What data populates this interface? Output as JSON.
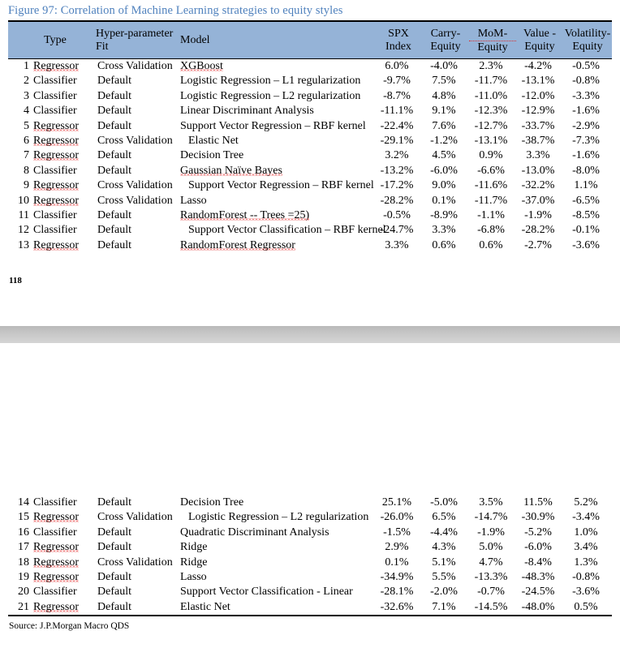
{
  "figure": {
    "caption": "Figure 97: Correlation of Machine Learning strategies to equity styles",
    "caption_color": "#4f81bd"
  },
  "page_number": "118",
  "source": "Source: J.P.Morgan Macro QDS",
  "table": {
    "header_bg": "#95b3d7",
    "columns": [
      {
        "key": "index",
        "label": ""
      },
      {
        "key": "type",
        "label": "Type"
      },
      {
        "key": "hyper_line1",
        "label": "Hyper-parameter"
      },
      {
        "key": "hyper_line2",
        "label": "Fit"
      },
      {
        "key": "model",
        "label": "Model"
      },
      {
        "key": "spx_line1",
        "label": "SPX"
      },
      {
        "key": "spx_line2",
        "label": "Index"
      },
      {
        "key": "carry_line1",
        "label": "Carry-"
      },
      {
        "key": "carry_line2",
        "label": "Equity"
      },
      {
        "key": "mom_line1",
        "label": "MoM-"
      },
      {
        "key": "mom_line2",
        "label": "Equity"
      },
      {
        "key": "value_line1",
        "label": "Value -"
      },
      {
        "key": "value_line2",
        "label": "Equity"
      },
      {
        "key": "vol_line1",
        "label": "Volatility-"
      },
      {
        "key": "vol_line2",
        "label": "Equity"
      }
    ],
    "rows_top": [
      {
        "index": "1",
        "type": "Regressor",
        "hyper": "Cross Validation",
        "model": "XGBoost",
        "indent": false,
        "spx": "6.0%",
        "carry": "-4.0%",
        "mom": "2.3%",
        "value": "-4.2%",
        "vol": "-0.5%"
      },
      {
        "index": "2",
        "type": "Classifier",
        "hyper": "Default",
        "model": "Logistic Regression – L1 regularization",
        "indent": false,
        "spx": "-9.7%",
        "carry": "7.5%",
        "mom": "-11.7%",
        "value": "-13.1%",
        "vol": "-0.8%"
      },
      {
        "index": "3",
        "type": "Classifier",
        "hyper": "Default",
        "model": "Logistic Regression – L2 regularization",
        "indent": false,
        "spx": "-8.7%",
        "carry": "4.8%",
        "mom": "-11.0%",
        "value": "-12.0%",
        "vol": "-3.3%"
      },
      {
        "index": "4",
        "type": "Classifier",
        "hyper": "Default",
        "model": "Linear Discriminant Analysis",
        "indent": false,
        "spx": "-11.1%",
        "carry": "9.1%",
        "mom": "-12.3%",
        "value": "-12.9%",
        "vol": "-1.6%"
      },
      {
        "index": "5",
        "type": "Regressor",
        "hyper": "Default",
        "model": "Support Vector Regression – RBF kernel",
        "indent": false,
        "spx": "-22.4%",
        "carry": "7.6%",
        "mom": "-12.7%",
        "value": "-33.7%",
        "vol": "-2.9%"
      },
      {
        "index": "6",
        "type": "Regressor",
        "hyper": "Cross Validation",
        "model": "Elastic Net",
        "indent": true,
        "spx": "-29.1%",
        "carry": "-1.2%",
        "mom": "-13.1%",
        "value": "-38.7%",
        "vol": "-7.3%"
      },
      {
        "index": "7",
        "type": "Regressor",
        "hyper": "Default",
        "model": "Decision Tree",
        "indent": false,
        "spx": "3.2%",
        "carry": "4.5%",
        "mom": "0.9%",
        "value": "3.3%",
        "vol": "-1.6%"
      },
      {
        "index": "8",
        "type": "Classifier",
        "hyper": "Default",
        "model": "Gaussian Naïve Bayes",
        "indent": false,
        "spx": "-13.2%",
        "carry": "-6.0%",
        "mom": "-6.6%",
        "value": "-13.0%",
        "vol": "-8.0%"
      },
      {
        "index": "9",
        "type": "Regressor",
        "hyper": "Cross Validation",
        "model": "Support Vector Regression – RBF kernel",
        "indent": true,
        "spx": "-17.2%",
        "carry": "9.0%",
        "mom": "-11.6%",
        "value": "-32.2%",
        "vol": "1.1%"
      },
      {
        "index": "10",
        "type": "Regressor",
        "hyper": "Cross Validation",
        "model": "Lasso",
        "indent": false,
        "spx": "-28.2%",
        "carry": "0.1%",
        "mom": "-11.7%",
        "value": "-37.0%",
        "vol": "-6.5%"
      },
      {
        "index": "11",
        "type": "Classifier",
        "hyper": "Default",
        "model": "RandomForest -- Trees =25)",
        "indent": false,
        "spx": "-0.5%",
        "carry": "-8.9%",
        "mom": "-1.1%",
        "value": "-1.9%",
        "vol": "-8.5%"
      },
      {
        "index": "12",
        "type": "Classifier",
        "hyper": "Default",
        "model": "Support Vector Classification – RBF kernel",
        "indent": true,
        "spx": "-24.7%",
        "carry": "3.3%",
        "mom": "-6.8%",
        "value": "-28.2%",
        "vol": "-0.1%"
      },
      {
        "index": "13",
        "type": "Regressor",
        "hyper": "Default",
        "model": "RandomForest Regressor",
        "indent": false,
        "spx": "3.3%",
        "carry": "0.6%",
        "mom": "0.6%",
        "value": "-2.7%",
        "vol": "-3.6%"
      }
    ],
    "rows_bottom": [
      {
        "index": "14",
        "type": "Classifier",
        "hyper": "Default",
        "model": "Decision Tree",
        "indent": false,
        "spx": "25.1%",
        "carry": "-5.0%",
        "mom": "3.5%",
        "value": "11.5%",
        "vol": "5.2%"
      },
      {
        "index": "15",
        "type": "Regressor",
        "hyper": "Cross Validation",
        "model": "Logistic Regression – L2 regularization",
        "indent": true,
        "spx": "-26.0%",
        "carry": "6.5%",
        "mom": "-14.7%",
        "value": "-30.9%",
        "vol": "-3.4%"
      },
      {
        "index": "16",
        "type": "Classifier",
        "hyper": "Default",
        "model": "Quadratic Discriminant Analysis",
        "indent": false,
        "spx": "-1.5%",
        "carry": "-4.4%",
        "mom": "-1.9%",
        "value": "-5.2%",
        "vol": "1.0%"
      },
      {
        "index": "17",
        "type": "Regressor",
        "hyper": "Default",
        "model": "Ridge",
        "indent": false,
        "spx": "2.9%",
        "carry": "4.3%",
        "mom": "5.0%",
        "value": "-6.0%",
        "vol": "3.4%"
      },
      {
        "index": "18",
        "type": "Regressor",
        "hyper": "Cross Validation",
        "model": "Ridge",
        "indent": false,
        "spx": "0.1%",
        "carry": "5.1%",
        "mom": "4.7%",
        "value": "-8.4%",
        "vol": "1.3%"
      },
      {
        "index": "19",
        "type": "Regressor",
        "hyper": "Default",
        "model": "Lasso",
        "indent": false,
        "spx": "-34.9%",
        "carry": "5.5%",
        "mom": "-13.3%",
        "value": "-48.3%",
        "vol": "-0.8%"
      },
      {
        "index": "20",
        "type": "Classifier",
        "hyper": "Default",
        "model": "Support Vector Classification - Linear",
        "indent": false,
        "spx": "-28.1%",
        "carry": "-2.0%",
        "mom": "-0.7%",
        "value": "-24.5%",
        "vol": "-3.6%"
      },
      {
        "index": "21",
        "type": "Regressor",
        "hyper": "Default",
        "model": "Elastic Net",
        "indent": false,
        "spx": "-32.6%",
        "carry": "7.1%",
        "mom": "-14.5%",
        "value": "-48.0%",
        "vol": "0.5%"
      }
    ]
  }
}
